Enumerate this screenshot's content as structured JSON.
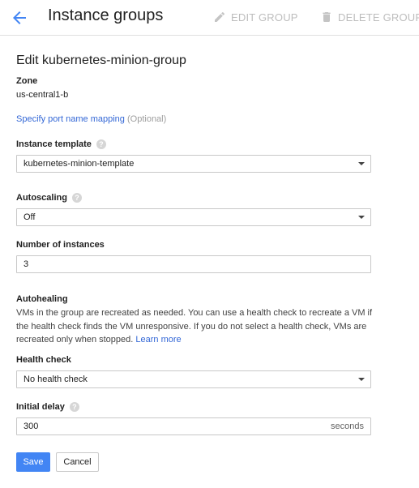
{
  "header": {
    "title": "Instance groups",
    "edit_label": "EDIT GROUP",
    "delete_label": "DELETE GROUP",
    "back_icon": "arrow-back-icon",
    "edit_icon": "pencil-icon",
    "delete_icon": "trash-icon",
    "accent_color": "#4285f4"
  },
  "form": {
    "title": "Edit kubernetes-minion-group",
    "zone_label": "Zone",
    "zone_value": "us-central1-b",
    "port_link": "Specify port name mapping",
    "port_optional": "(Optional)",
    "template_label": "Instance template",
    "template_value": "kubernetes-minion-template",
    "autoscaling_label": "Autoscaling",
    "autoscaling_value": "Off",
    "instances_label": "Number of instances",
    "instances_value": "3",
    "autohealing_label": "Autohealing",
    "autohealing_desc": "VMs in the group are recreated as needed. You can use a health check to recreate a VM if the health check finds the VM unresponsive. If you do not select a health check, VMs are recreated only when stopped.",
    "learn_more": "Learn more",
    "health_label": "Health check",
    "health_value": "No health check",
    "delay_label": "Initial delay",
    "delay_value": "300",
    "delay_suffix": "seconds",
    "help_glyph": "?"
  },
  "actions": {
    "save_label": "Save",
    "cancel_label": "Cancel"
  }
}
